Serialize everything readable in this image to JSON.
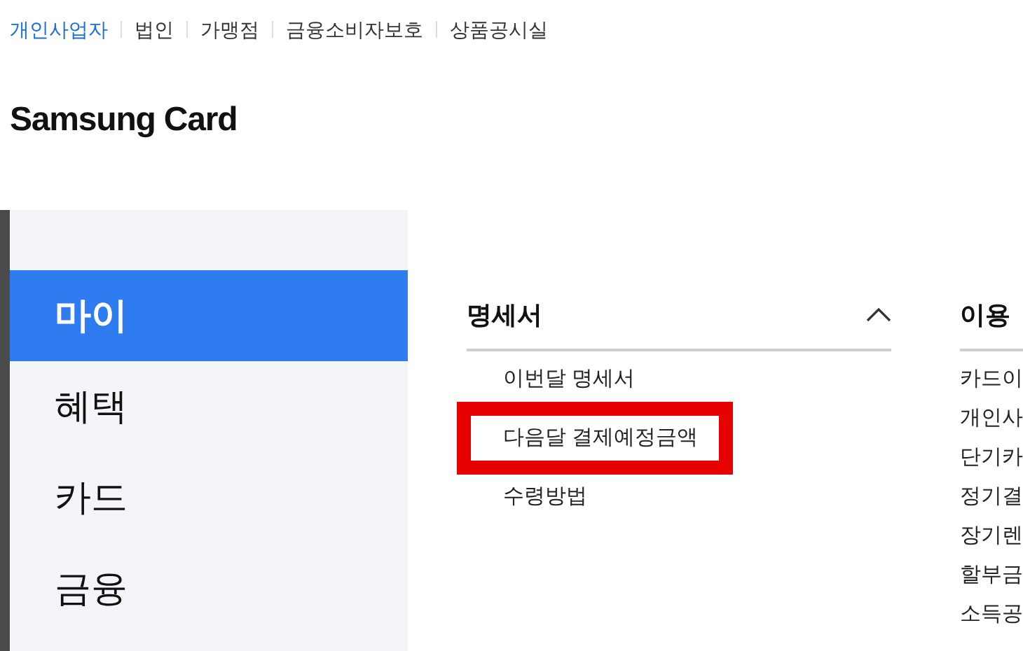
{
  "top_links": [
    {
      "label": "개인사업자",
      "selected": true
    },
    {
      "label": "법인",
      "selected": false
    },
    {
      "label": "가맹점",
      "selected": false
    },
    {
      "label": "금융소비자보호",
      "selected": false
    },
    {
      "label": "상품공시실",
      "selected": false
    }
  ],
  "brand": "Samsung Card",
  "sidebar": {
    "items": [
      {
        "label": "마이",
        "selected": true
      },
      {
        "label": "혜택",
        "selected": false
      },
      {
        "label": "카드",
        "selected": false
      },
      {
        "label": "금융",
        "selected": false
      }
    ]
  },
  "sections": [
    {
      "title": "명세서",
      "expanded": true,
      "items": [
        {
          "label": "이번달 명세서",
          "highlighted": false
        },
        {
          "label": "다음달 결제예정금액",
          "highlighted": true
        },
        {
          "label": "수령방법",
          "highlighted": false
        }
      ]
    },
    {
      "title": "이용",
      "items": [
        {
          "label": "카드이",
          "highlighted": false
        },
        {
          "label": "개인사",
          "highlighted": false
        },
        {
          "label": "단기카",
          "highlighted": false
        },
        {
          "label": "정기결",
          "highlighted": false
        },
        {
          "label": "장기렌",
          "highlighted": false
        },
        {
          "label": "할부금",
          "highlighted": false
        },
        {
          "label": "소득공",
          "highlighted": false
        }
      ]
    }
  ]
}
